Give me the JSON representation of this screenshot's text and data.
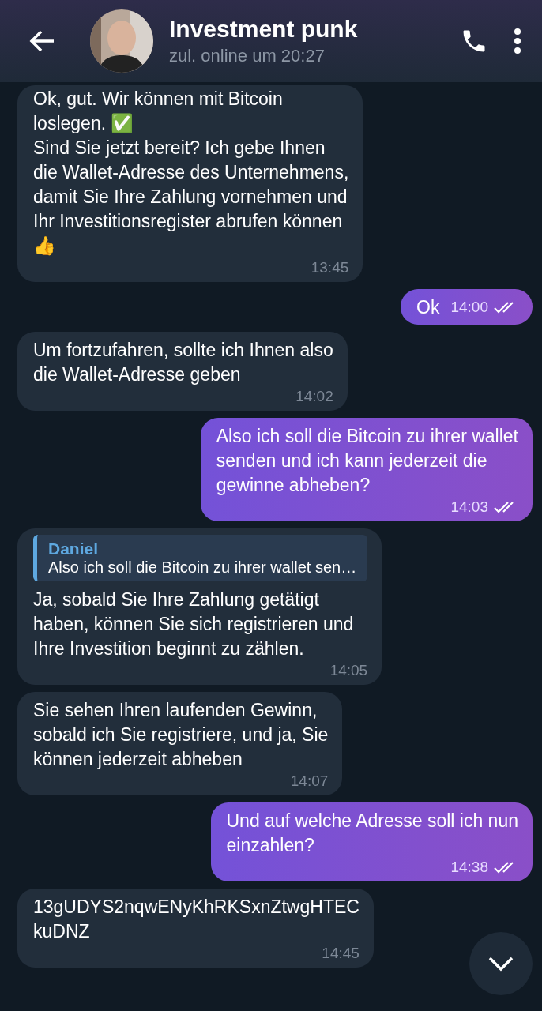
{
  "header": {
    "title": "Investment punk",
    "status": "zul. online um 20:27"
  },
  "messages": [
    {
      "kind": "incoming",
      "text": "Ok, gut. Wir können mit Bitcoin\nloslegen. ✅\nSind Sie jetzt bereit? Ich gebe Ihnen\ndie Wallet-Adresse des Unternehmens,\ndamit Sie Ihre Zahlung vornehmen und\nIhr Investitionsregister abrufen können\n👍",
      "time": "13:45"
    },
    {
      "kind": "outgoing",
      "text": "Ok",
      "time": "14:00",
      "read": true
    },
    {
      "kind": "incoming",
      "text": "Um fortzufahren, sollte ich Ihnen also\ndie Wallet-Adresse geben",
      "time": "14:02"
    },
    {
      "kind": "outgoing",
      "text": "Also ich soll die Bitcoin zu ihrer wallet\nsenden und ich kann jederzeit die\ngewinne abheben?",
      "time": "14:03",
      "read": true
    },
    {
      "kind": "incoming",
      "reply": {
        "author": "Daniel",
        "text": "Also ich soll die Bitcoin zu ihrer wallet sen…"
      },
      "text": "Ja, sobald Sie Ihre Zahlung getätigt\nhaben, können Sie sich registrieren und\nIhre Investition beginnt zu zählen.",
      "time": "14:05"
    },
    {
      "kind": "incoming",
      "text": "Sie sehen Ihren laufenden Gewinn,\nsobald ich Sie registriere, und ja, Sie\nkönnen jederzeit abheben",
      "time": "14:07"
    },
    {
      "kind": "outgoing",
      "text": "Und auf welche Adresse soll ich nun\neinzahlen?",
      "time": "14:38",
      "read": true
    },
    {
      "kind": "incoming",
      "text": "13gUDYS2nqwENyKhRKSxnZtwgHTEC\nkuDNZ",
      "time": "14:45"
    }
  ]
}
